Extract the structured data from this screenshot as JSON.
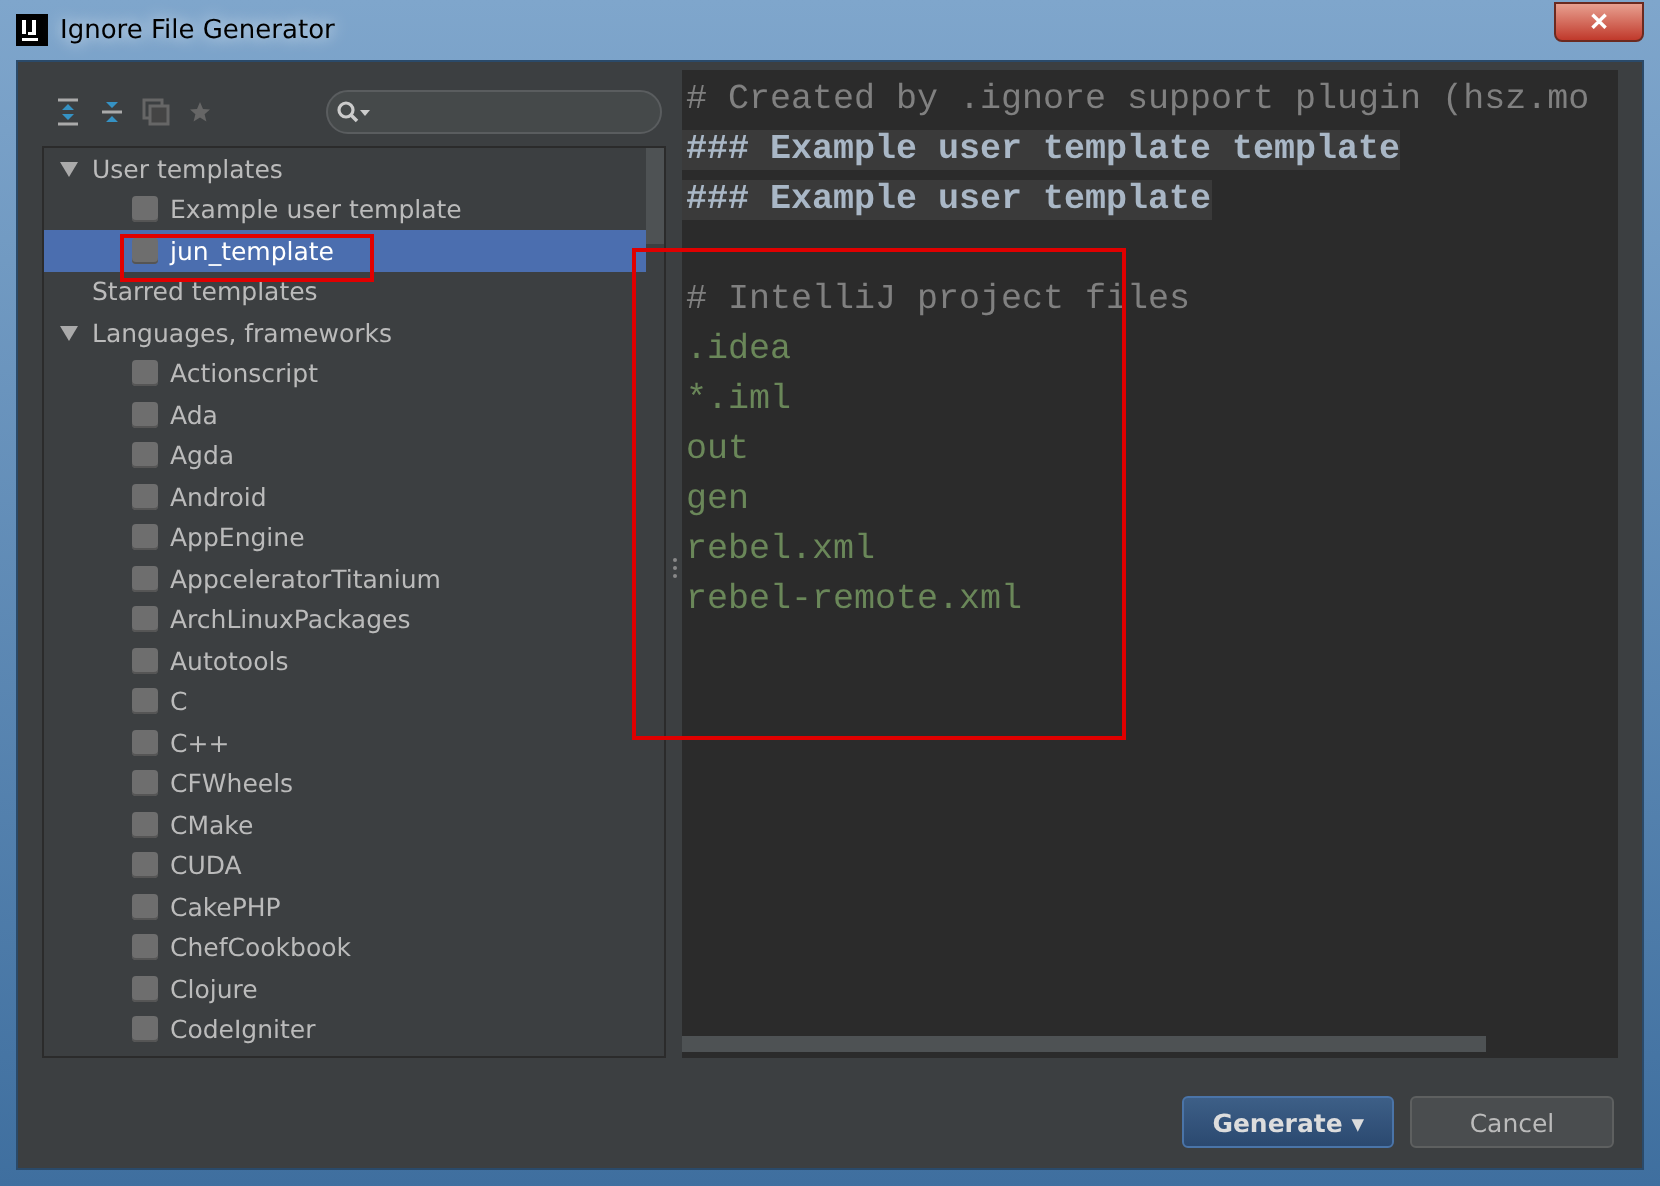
{
  "window": {
    "title": "Ignore File Generator",
    "close_label": "✕"
  },
  "tree": [
    {
      "label": "User templates",
      "expanded": true,
      "children": [
        {
          "label": "Example user template",
          "checked": false,
          "selected": false
        },
        {
          "label": "jun_template",
          "checked": false,
          "selected": true
        }
      ]
    },
    {
      "label": "Starred templates"
    },
    {
      "label": "Languages, frameworks",
      "expanded": true,
      "children": [
        {
          "label": "Actionscript",
          "checked": false,
          "selected": false
        },
        {
          "label": "Ada",
          "checked": false,
          "selected": false
        },
        {
          "label": "Agda",
          "checked": false,
          "selected": false
        },
        {
          "label": "Android",
          "checked": false,
          "selected": false
        },
        {
          "label": "AppEngine",
          "checked": false,
          "selected": false
        },
        {
          "label": "AppceleratorTitanium",
          "checked": false,
          "selected": false
        },
        {
          "label": "ArchLinuxPackages",
          "checked": false,
          "selected": false
        },
        {
          "label": "Autotools",
          "checked": false,
          "selected": false
        },
        {
          "label": "C",
          "checked": false,
          "selected": false
        },
        {
          "label": "C++",
          "checked": false,
          "selected": false
        },
        {
          "label": "CFWheels",
          "checked": false,
          "selected": false
        },
        {
          "label": "CMake",
          "checked": false,
          "selected": false
        },
        {
          "label": "CUDA",
          "checked": false,
          "selected": false
        },
        {
          "label": "CakePHP",
          "checked": false,
          "selected": false
        },
        {
          "label": "ChefCookbook",
          "checked": false,
          "selected": false
        },
        {
          "label": "Clojure",
          "checked": false,
          "selected": false
        },
        {
          "label": "CodeIgniter",
          "checked": false,
          "selected": false
        }
      ]
    }
  ],
  "editor": {
    "lines": [
      {
        "kind": "comment",
        "text": "# Created by .ignore support plugin (hsz.mo"
      },
      {
        "kind": "header",
        "text": "### Example user template template"
      },
      {
        "kind": "header",
        "text": "### Example user template"
      },
      {
        "kind": "blank"
      },
      {
        "kind": "comment",
        "text": "# IntelliJ project files"
      },
      {
        "kind": "path",
        "text": ".idea"
      },
      {
        "kind": "path",
        "text": "*.iml"
      },
      {
        "kind": "path",
        "text": "out"
      },
      {
        "kind": "path",
        "text": "gen"
      },
      {
        "kind": "path",
        "text": "rebel.xml"
      },
      {
        "kind": "path",
        "text": "rebel-remote.xml"
      }
    ]
  },
  "buttons": [
    {
      "label": "Generate",
      "kind": "primary",
      "caret": "▾"
    },
    {
      "label": "Cancel",
      "kind": "secondary"
    }
  ]
}
